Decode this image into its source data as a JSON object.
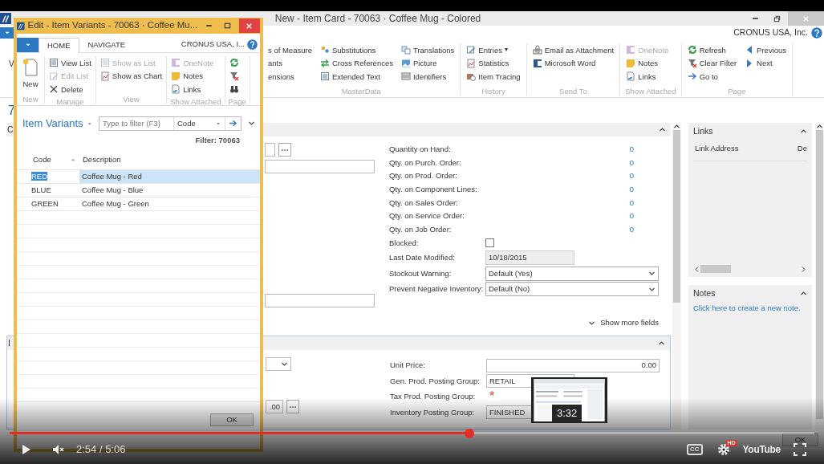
{
  "main_window": {
    "title": "New - Item Card - 70063 · Coffee Mug - Colored",
    "company": "CRONUS USA, Inc.",
    "ribbon_left_fragment": "V",
    "ribbon": [
      {
        "label": "MasterData",
        "columns": [
          [
            {
              "label": "s of Measure",
              "disabled": false
            },
            {
              "label": "ants",
              "disabled": false
            },
            {
              "label": "ensions",
              "disabled": false
            }
          ],
          [
            {
              "label": "Substitutions",
              "disabled": false
            },
            {
              "label": "Cross References",
              "disabled": false
            },
            {
              "label": "Extended Text",
              "disabled": false
            }
          ],
          [
            {
              "label": "Translations",
              "disabled": false
            },
            {
              "label": "Picture",
              "disabled": false
            },
            {
              "label": "Identifiers",
              "disabled": false
            }
          ]
        ]
      },
      {
        "label": "History",
        "columns": [
          [
            {
              "label": "Entries",
              "caret": "▾",
              "disabled": false
            },
            {
              "label": "Statistics",
              "disabled": false
            },
            {
              "label": "Item Tracing",
              "disabled": false
            }
          ]
        ]
      },
      {
        "label": "Send To",
        "columns": [
          [
            {
              "label": "Email as Attachment",
              "disabled": false
            },
            {
              "label": "Microsoft Word",
              "disabled": false
            }
          ]
        ]
      },
      {
        "label": "Show Attached",
        "columns": [
          [
            {
              "label": "OneNote",
              "disabled": true
            },
            {
              "label": "Notes",
              "disabled": false
            },
            {
              "label": "Links",
              "disabled": false
            }
          ]
        ]
      },
      {
        "label": "Page",
        "columns": [
          [
            {
              "label": "Refresh",
              "disabled": false
            },
            {
              "label": "Clear Filter",
              "disabled": false
            },
            {
              "label": "Go to",
              "disabled": false
            }
          ],
          [
            {
              "label": "Previous",
              "disabled": false
            },
            {
              "label": "Next",
              "disabled": false
            }
          ]
        ]
      }
    ],
    "page_title": "7",
    "general": {
      "header": "C",
      "fields": [
        {
          "label": "Quantity on Hand:",
          "kind": "number",
          "value": "0"
        },
        {
          "label": "Qty. on Purch. Order:",
          "kind": "number",
          "value": "0"
        },
        {
          "label": "Qty. on Prod. Order:",
          "kind": "number",
          "value": "0"
        },
        {
          "label": "Qty. on Component Lines:",
          "kind": "number",
          "value": "0"
        },
        {
          "label": "Qty. on Sales Order:",
          "kind": "number",
          "value": "0"
        },
        {
          "label": "Qty. on Service Order:",
          "kind": "number",
          "value": "0"
        },
        {
          "label": "Qty. on Job Order:",
          "kind": "number",
          "value": "0"
        },
        {
          "label": "Blocked:",
          "kind": "checkbox",
          "checked": false
        },
        {
          "label": "Last Date Modified:",
          "kind": "readonly",
          "value": "10/18/2015"
        },
        {
          "label": "Stockout Warning:",
          "kind": "select",
          "value": "Default (Yes)"
        },
        {
          "label": "Prevent Negative Inventory:",
          "kind": "select",
          "value": "Default (No)"
        }
      ],
      "more": "Show more fields"
    },
    "invoicing": {
      "header": "I",
      "partial_value": ".00",
      "fields": [
        {
          "label": "Unit Price:",
          "kind": "amount",
          "value": "0.00"
        },
        {
          "label": "Gen. Prod. Posting Group:",
          "kind": "code",
          "value": "RETAIL"
        },
        {
          "label": "Tax Prod. Posting Group:",
          "kind": "required",
          "value": "*"
        },
        {
          "label": "Inventory Posting Group:",
          "kind": "code",
          "value": "FINISHED"
        }
      ]
    },
    "links": {
      "title": "Links",
      "column": "Link Address",
      "column_2": "De"
    },
    "notes": {
      "title": "Notes",
      "link": "Click here to create a new note."
    },
    "ok": "OK"
  },
  "dialog": {
    "title": "Edit - Item Variants - 70063 · Coffee Mu...",
    "company": "CRONUS USA, I...",
    "tabs": [
      {
        "label": "HOME",
        "selected": true
      },
      {
        "label": "NAVIGATE",
        "selected": false
      }
    ],
    "ribbon": [
      {
        "label": "New",
        "kind": "large",
        "columns": [
          [
            {
              "label": "New",
              "disabled": false
            }
          ]
        ]
      },
      {
        "label": "Manage",
        "kind": "small",
        "columns": [
          [
            {
              "label": "View List",
              "disabled": false
            },
            {
              "label": "Edit List",
              "disabled": true
            },
            {
              "label": "Delete",
              "disabled": false
            }
          ]
        ]
      },
      {
        "label": "View",
        "kind": "small",
        "columns": [
          [
            {
              "label": "Show as List",
              "disabled": true
            },
            {
              "label": "Show as Chart",
              "disabled": false
            }
          ]
        ]
      },
      {
        "label": "Show Attached",
        "kind": "small",
        "columns": [
          [
            {
              "label": "OneNote",
              "disabled": true
            },
            {
              "label": "Notes",
              "disabled": false
            },
            {
              "label": "Links",
              "disabled": false
            }
          ]
        ]
      },
      {
        "label": "Page",
        "kind": "small",
        "columns": [
          [
            {
              "disabled": false
            },
            {
              "disabled": false
            },
            {
              "disabled": false
            }
          ]
        ]
      }
    ],
    "list_title": "Item Variants",
    "filter": {
      "placeholder": "Type to filter (F3)",
      "field": "Code"
    },
    "filter_caption": "Filter: 70063",
    "columns": [
      "Code",
      "Description"
    ],
    "rows": [
      {
        "code": "RED",
        "description": "Coffee Mug - Red",
        "selected": true
      },
      {
        "code": "BLUE",
        "description": "Coffee Mug - Blue",
        "selected": false
      },
      {
        "code": "GREEN",
        "description": "Coffee Mug - Green",
        "selected": false
      }
    ],
    "ok": "OK"
  },
  "player": {
    "progress": {
      "level": 0.571
    },
    "time": "2:54 / 5:06",
    "preview_time": "3:32",
    "captions": "CC",
    "hd": "HD",
    "logo": "YouTube"
  }
}
